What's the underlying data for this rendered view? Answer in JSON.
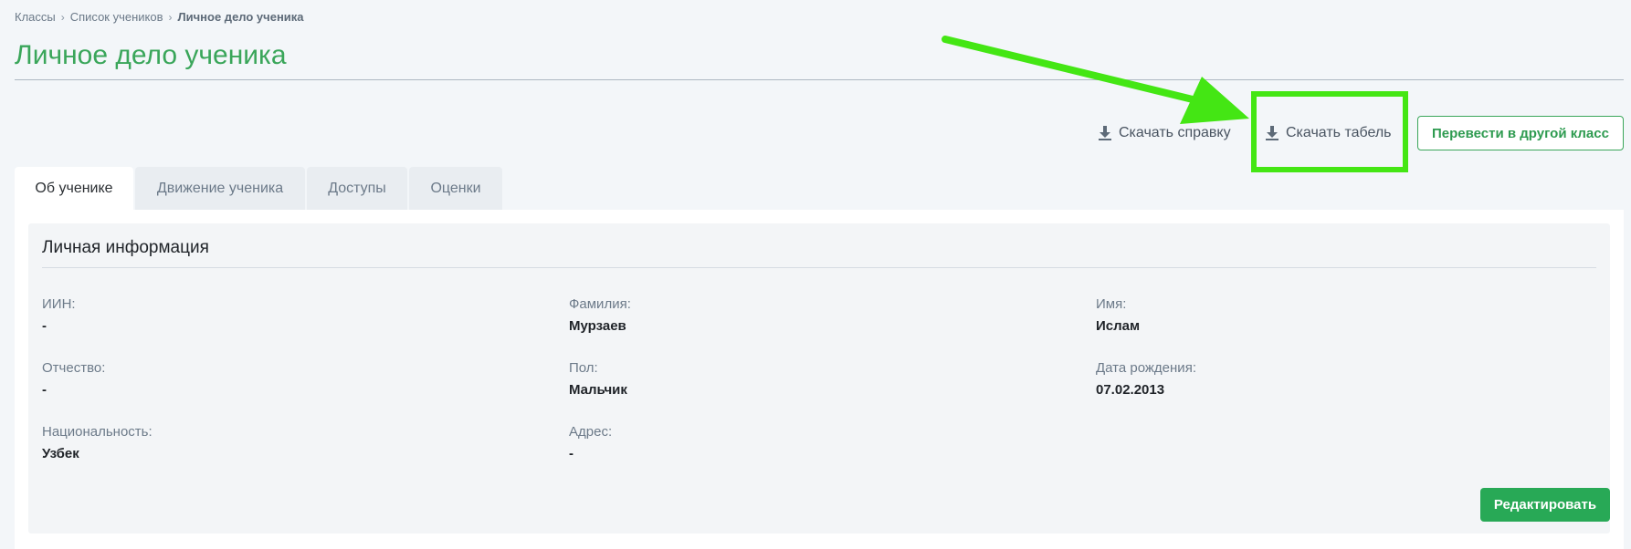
{
  "breadcrumb": {
    "items": [
      "Классы",
      "Список учеников"
    ],
    "current": "Личное дело ученика",
    "separator": "›"
  },
  "page": {
    "title": "Личное дело ученика"
  },
  "actions": {
    "download_certificate": "Скачать справку",
    "download_table": "Скачать табель",
    "transfer": "Перевести в другой класс"
  },
  "tabs": [
    {
      "label": "Об ученике",
      "active": true
    },
    {
      "label": "Движение ученика",
      "active": false
    },
    {
      "label": "Доступы",
      "active": false
    },
    {
      "label": "Оценки",
      "active": false
    }
  ],
  "personal": {
    "title": "Личная информация",
    "fields": {
      "iin": {
        "label": "ИИН:",
        "value": "-"
      },
      "surname": {
        "label": "Фамилия:",
        "value": "Мурзаев"
      },
      "name": {
        "label": "Имя:",
        "value": "Ислам"
      },
      "patronymic": {
        "label": "Отчество:",
        "value": "-"
      },
      "gender": {
        "label": "Пол:",
        "value": "Мальчик"
      },
      "birthdate": {
        "label": "Дата рождения:",
        "value": "07.02.2013"
      },
      "nationality": {
        "label": "Национальность:",
        "value": "Узбек"
      },
      "address": {
        "label": "Адрес:",
        "value": "-"
      }
    },
    "edit_label": "Редактировать"
  },
  "colors": {
    "accent_green": "#3aa65a",
    "button_green": "#28a956",
    "highlight_green": "#44e614",
    "background": "#f3f6f9"
  },
  "icons": {
    "download": "download-icon"
  }
}
